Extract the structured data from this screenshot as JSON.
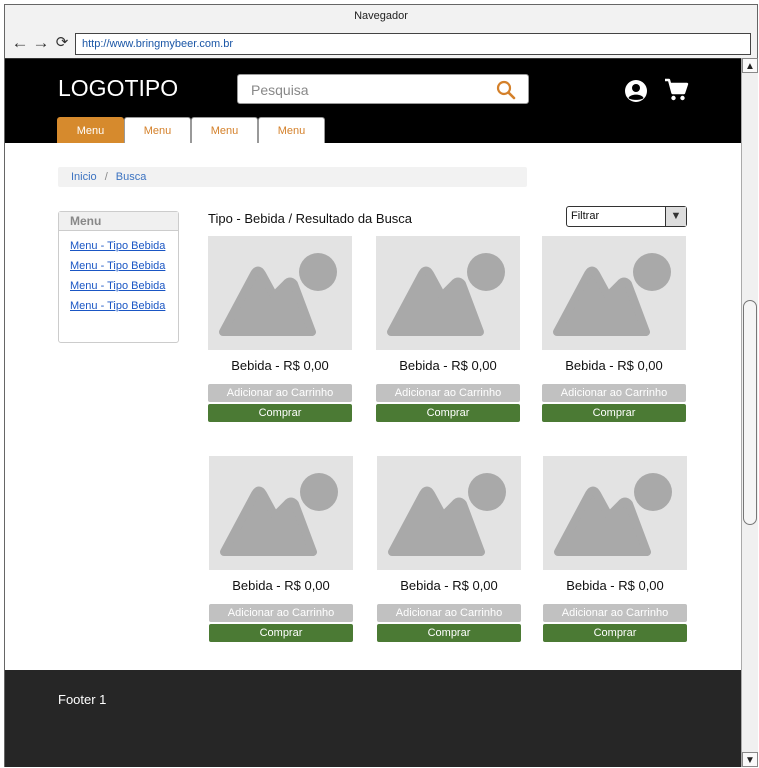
{
  "browser": {
    "title": "Navegador",
    "url": "http://www.bringmybeer.com.br",
    "back_glyph": "←",
    "forward_glyph": "→",
    "reload_glyph": "⟳"
  },
  "header": {
    "logo": "LOGOTIPO",
    "search_placeholder": "Pesquisa",
    "menu_tabs": [
      "Menu",
      "Menu",
      "Menu",
      "Menu"
    ]
  },
  "breadcrumb": {
    "items": [
      "Inicio",
      "Busca"
    ],
    "separator": "/"
  },
  "sidebar": {
    "title": "Menu",
    "links": [
      "Menu - Tipo Bebida",
      "Menu - Tipo Bebida",
      "Menu - Tipo Bebida",
      "Menu - Tipo Bebida"
    ]
  },
  "results": {
    "title": "Tipo - Bebida / Resultado da Busca",
    "filter": {
      "selected": "Filtrar",
      "arrow": "▼"
    }
  },
  "products": [
    {
      "name": "Bebida - R$ 0,00",
      "add_label": "Adicionar ao Carrinho",
      "buy_label": "Comprar"
    },
    {
      "name": "Bebida - R$ 0,00",
      "add_label": "Adicionar ao Carrinho",
      "buy_label": "Comprar"
    },
    {
      "name": "Bebida - R$ 0,00",
      "add_label": "Adicionar ao Carrinho",
      "buy_label": "Comprar"
    },
    {
      "name": "Bebida - R$ 0,00",
      "add_label": "Adicionar ao Carrinho",
      "buy_label": "Comprar"
    },
    {
      "name": "Bebida - R$ 0,00",
      "add_label": "Adicionar ao Carrinho",
      "buy_label": "Comprar"
    },
    {
      "name": "Bebida - R$ 0,00",
      "add_label": "Adicionar ao Carrinho",
      "buy_label": "Comprar"
    }
  ],
  "footer": {
    "text": "Footer 1"
  },
  "scrollbar": {
    "up_glyph": "▲",
    "down_glyph": "▼"
  },
  "colors": {
    "header_bg": "#000000",
    "accent": "#d68a2d",
    "buy_button": "#4b7a34",
    "add_button": "#c1c1c1",
    "footer_bg": "#262626",
    "link": "#1a56c4"
  },
  "icons": {
    "search": "search-icon",
    "user": "user-icon",
    "cart": "cart-icon",
    "image_placeholder": "image-placeholder-icon"
  }
}
